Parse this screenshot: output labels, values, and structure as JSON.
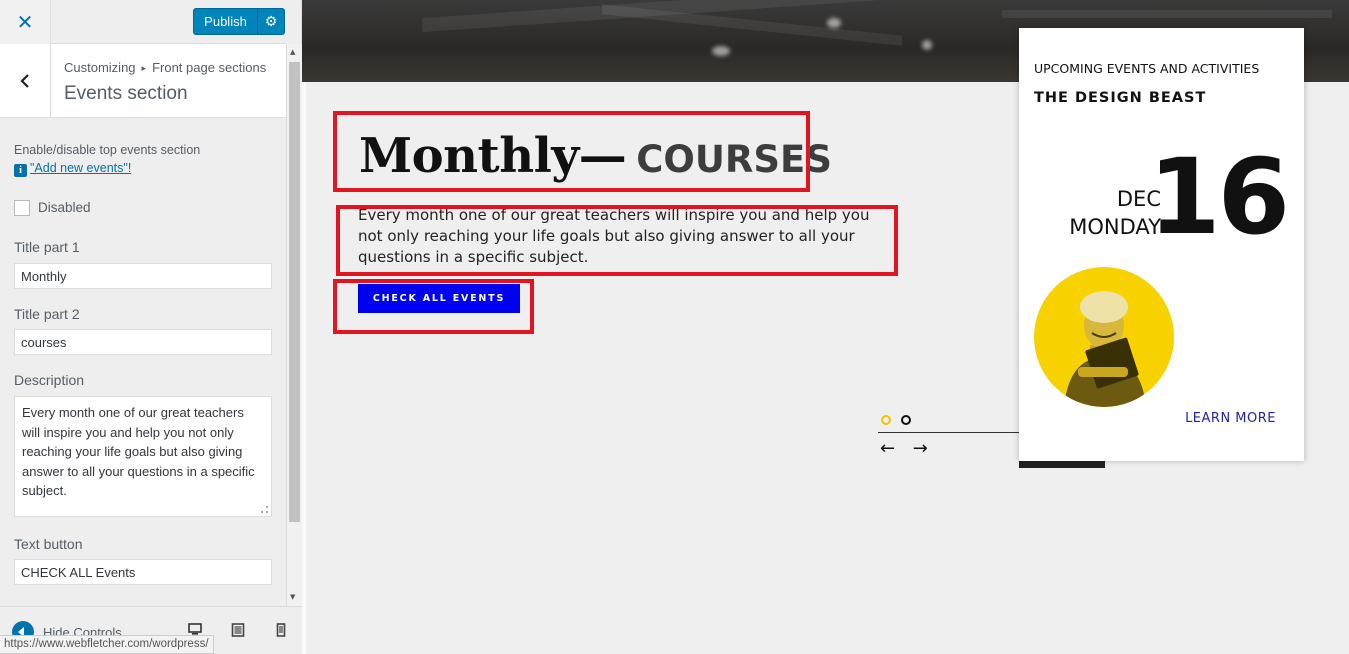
{
  "sidebar": {
    "close_icon": "close-icon",
    "publish_label": "Publish",
    "breadcrumb_root": "Customizing",
    "breadcrumb_sep": "▸",
    "breadcrumb_parent": "Front page sections",
    "section_title": "Events section",
    "controls": {
      "toggle_description": "Enable/disable top events section",
      "add_events_link": "\"Add new events\"!",
      "disabled_label": "Disabled",
      "disabled_checked": false,
      "title_part1_label": "Title part 1",
      "title_part1_value": "Monthly",
      "title_part2_label": "Title part 2",
      "title_part2_value": "courses",
      "description_label": "Description",
      "description_value": "Every month one of our great  teachers will inspire you and help you not only reaching your life goals but also giving answer to all your questions in a specific subject.",
      "text_button_label": "Text button",
      "text_button_value": "CHECK ALL Events"
    },
    "footer": {
      "hide_controls_label": "Hide Controls",
      "devices": [
        "desktop-icon",
        "tablet-icon",
        "mobile-icon"
      ]
    },
    "status_url": "https://www.webfletcher.com/wordpress/"
  },
  "preview": {
    "title_part1": "Monthly—",
    "title_part2": "courses",
    "description": "Every month one of our great teachers will inspire you and help you not only reaching your life goals but also giving answer to all your questions in a specific subject.",
    "button_label": "Check all events",
    "slider_arrows": "← →",
    "card": {
      "heading": "UPCOMING EVENTS AND ACTIVITIES",
      "name": "THE DESIGN BEAST",
      "month": "DEC",
      "weekday": "MONDAY",
      "day": "16",
      "cta": "Learn more"
    }
  },
  "colors": {
    "wp_blue": "#0073aa",
    "publish_blue": "#0085ba",
    "event_button": "#0000f0",
    "annotation_red": "#e0151f",
    "accent_yellow": "#f7d200",
    "learn_more": "#2222aa"
  }
}
